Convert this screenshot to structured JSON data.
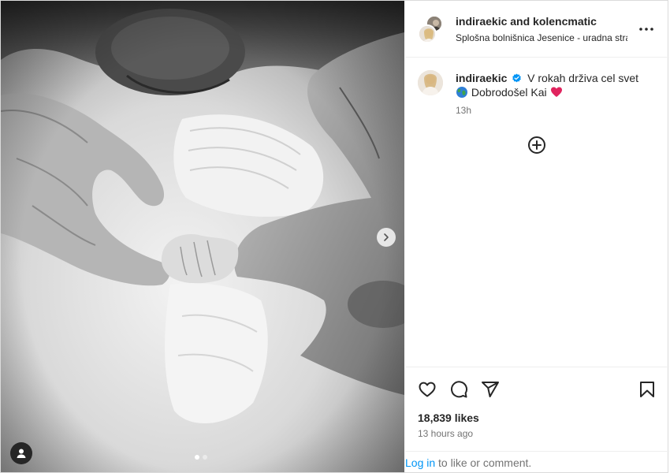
{
  "header": {
    "user1": "indiraekic",
    "and": "and",
    "user2": "kolencmatic",
    "location": "Splošna bolnišnica Jesenice - uradna stran"
  },
  "caption": {
    "username": "indiraekic",
    "line1": "V rokah drživa cel svet",
    "line2": "Dobrodošel Kai",
    "time": "13h"
  },
  "stats": {
    "likes": "18,839 likes",
    "posted": "13 hours ago"
  },
  "footer": {
    "login": "Log in",
    "rest": " to like or comment."
  },
  "carousel": {
    "slides": 2,
    "current": 1
  },
  "icons": [
    "more-icon",
    "verified-icon",
    "globe-emoji",
    "heart-emoji",
    "add-circle-icon",
    "heart-icon",
    "comment-icon",
    "share-icon",
    "bookmark-icon",
    "next-arrow-icon",
    "user-tag-icon"
  ],
  "colors": {
    "link": "#0095f6",
    "verified": "#0095f6",
    "heart": "#e0245e"
  }
}
